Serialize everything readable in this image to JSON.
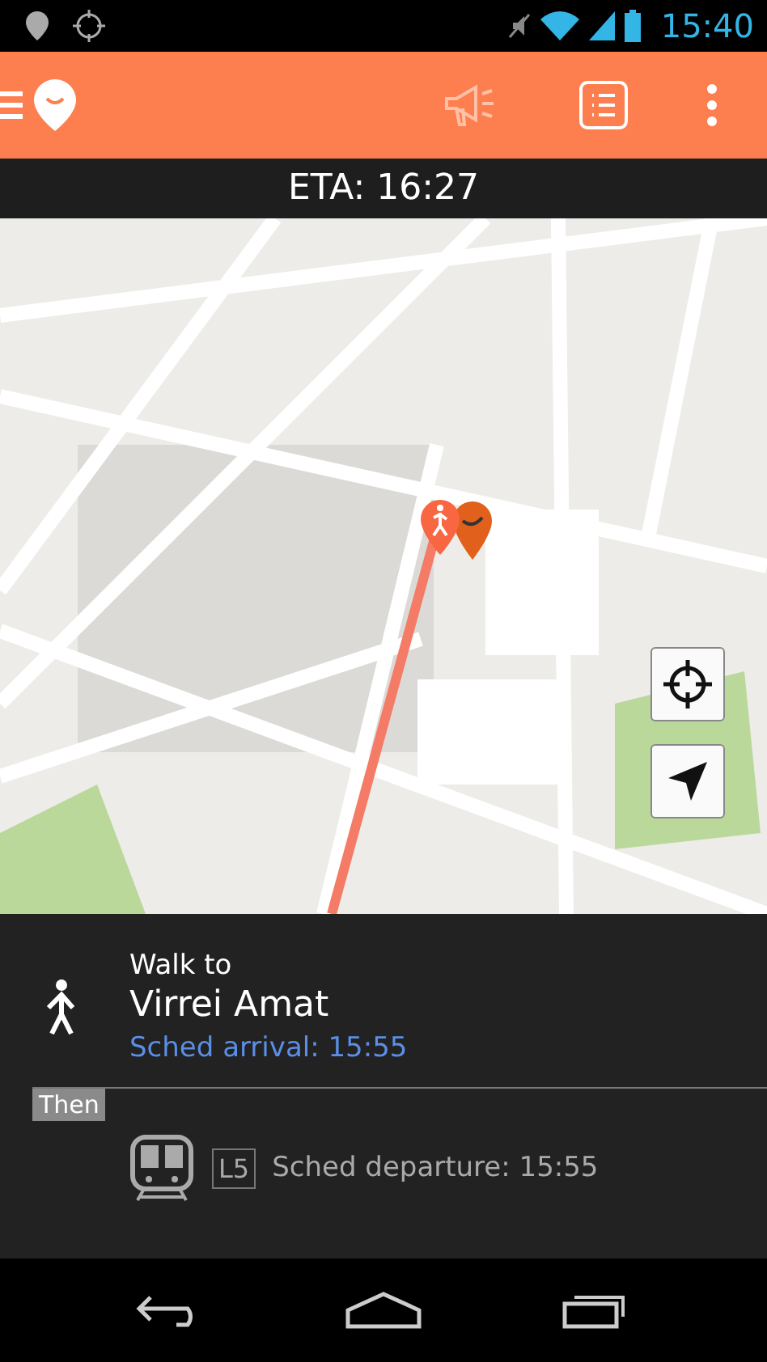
{
  "status_bar": {
    "time": "15:40"
  },
  "eta": "ETA: 16:27",
  "current_step": {
    "kind": "walk",
    "instruction": "Walk to",
    "destination": "Virrei Amat",
    "schedule": "Sched arrival: 15:55"
  },
  "next_step": {
    "label": "Then",
    "kind": "metro",
    "line": "L5",
    "schedule": "Sched departure: 15:55"
  }
}
